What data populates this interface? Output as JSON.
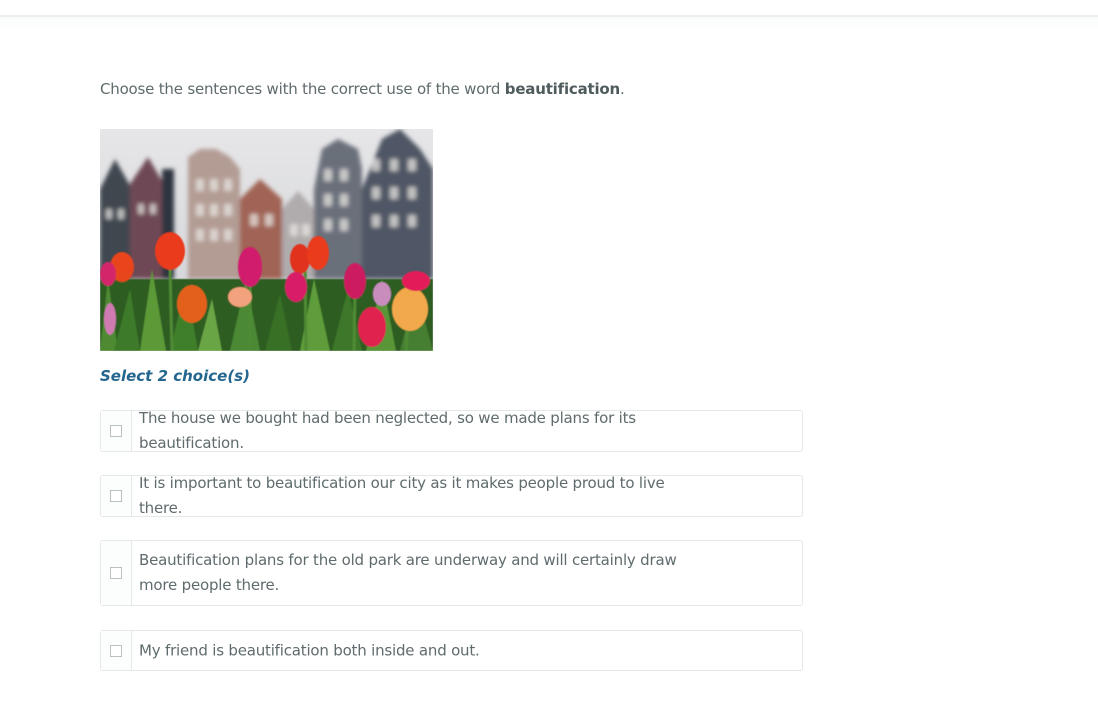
{
  "question": {
    "prefix": "Choose the sentences with the correct use of the word ",
    "keyword": "beautification",
    "suffix": "."
  },
  "image": {
    "description_icon": "tulips-photo"
  },
  "instruction": "Select 2 choice(s)",
  "choices": [
    {
      "text": "The house we bought had been neglected, so we made plans for its beautification.",
      "checked": false
    },
    {
      "text": "It is important to beautification our city as it makes people proud to live there.",
      "checked": false
    },
    {
      "text": "Beautification plans for the old park are underway and will certainly draw more people there.",
      "checked": false
    },
    {
      "text": "My friend is beautification both inside and out.",
      "checked": false
    }
  ],
  "colors": {
    "accent": "#23668f",
    "text": "#5f6b6d",
    "border": "#e4e8e8"
  }
}
